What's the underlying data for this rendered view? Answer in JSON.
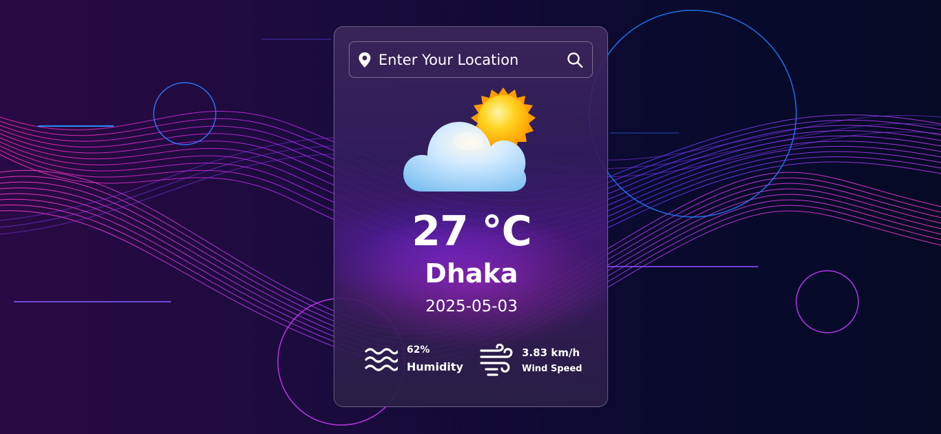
{
  "search": {
    "placeholder": "Enter Your Location"
  },
  "weather": {
    "condition_icon": "partly-cloudy-icon",
    "temperature": "27 °C",
    "city": "Dhaka",
    "date": "2025-05-03"
  },
  "stats": {
    "humidity": {
      "value": "62%",
      "label": "Humidity",
      "icon": "waves-icon"
    },
    "wind": {
      "value": "3.83 km/h",
      "label": "Wind Speed",
      "icon": "wind-icon"
    }
  },
  "colors": {
    "text": "#ffffff",
    "wave_magenta": "#e040fb",
    "wave_blue": "#5b3dff",
    "sun": "#ffb300",
    "cloud": "#bfe3ff"
  }
}
